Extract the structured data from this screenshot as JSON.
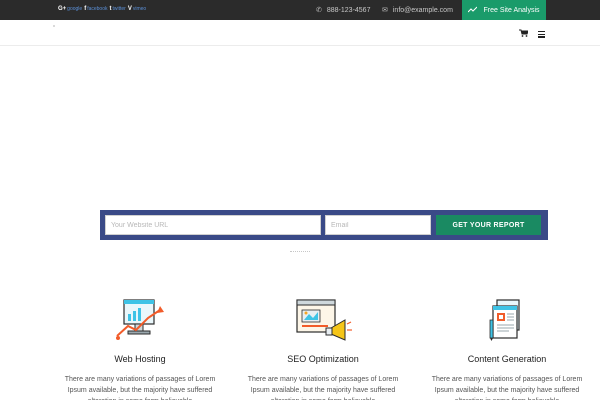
{
  "topbar": {
    "social": [
      {
        "icon": "google-plus-icon",
        "glyph": "G+",
        "label": "google"
      },
      {
        "icon": "facebook-icon",
        "glyph": "f",
        "label": "facebook"
      },
      {
        "icon": "twitter-icon",
        "glyph": "t",
        "label": "twitter"
      },
      {
        "icon": "vimeo-icon",
        "glyph": "V",
        "label": "vimeo"
      }
    ],
    "phone": "888-123-4567",
    "email": "info@example.com",
    "cta_label": "Free Site Analysis"
  },
  "nav": {
    "cart_icon": "shopping-cart-icon",
    "menu_icon": "hamburger-menu-icon"
  },
  "form": {
    "url_placeholder": "Your Website URL",
    "email_placeholder": "Email",
    "button_label": "GET YOUR REPORT"
  },
  "services": [
    {
      "title": "Web Hosting",
      "icon": "analytics-monitor-icon",
      "text": "There are many variations of passages of Lorem Ipsum available, but the majority have suffered alteration in some form believable"
    },
    {
      "title": "SEO Optimization",
      "icon": "megaphone-browser-icon",
      "text": "There are many variations of passages of Lorem Ipsum available, but the majority have suffered alteration in some form believable"
    },
    {
      "title": "Content Generation",
      "icon": "documents-pen-icon",
      "text": "There are many variations of passages of Lorem Ipsum available, but the majority have suffered alteration in some form believable"
    }
  ],
  "colors": {
    "topbar_bg": "#2b2b2b",
    "accent_green": "#1a9b6a",
    "form_bg": "#3a4a87"
  }
}
